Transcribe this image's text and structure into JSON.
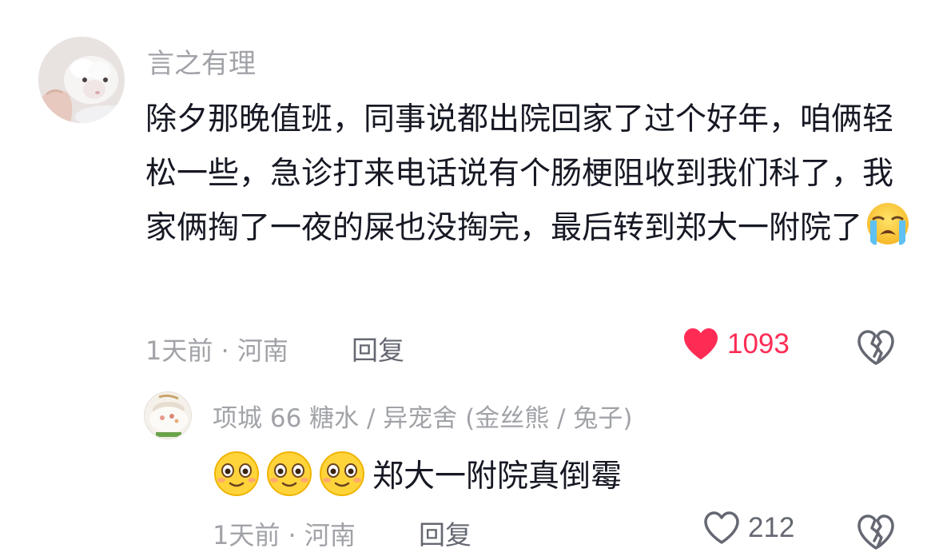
{
  "colors": {
    "username": "#a1a3a8",
    "text": "#161823",
    "meta": "#a1a3a8",
    "like_active": "#fe2c55",
    "icon_gray": "#656872"
  },
  "comment": {
    "username": "言之有理",
    "text": "除夕那晚值班，同事说都出院回家了过个好年，咱俩轻松一些，急诊打来电话说有个肠梗阻收到我们科了，我家俩掏了一夜的屎也没掏完，最后转到郑大一附院了",
    "emoji": "loudly-crying-face",
    "time_location": "1天前 · 河南",
    "reply_label": "回复",
    "like_count": "1093",
    "liked": true,
    "like_icon": "heart-filled-icon",
    "dislike_icon": "broken-heart-icon"
  },
  "reply": {
    "username": "项城 66 糖水 / 异宠舍 (金丝熊 / 兔子)",
    "emojis": [
      "smiling-face",
      "smiling-face",
      "smiling-face"
    ],
    "text": "郑大一附院真倒霉",
    "time_location": "1天前 · 河南",
    "reply_label": "回复",
    "like_count": "212",
    "liked": false,
    "like_icon": "heart-outline-icon",
    "dislike_icon": "broken-heart-icon"
  }
}
